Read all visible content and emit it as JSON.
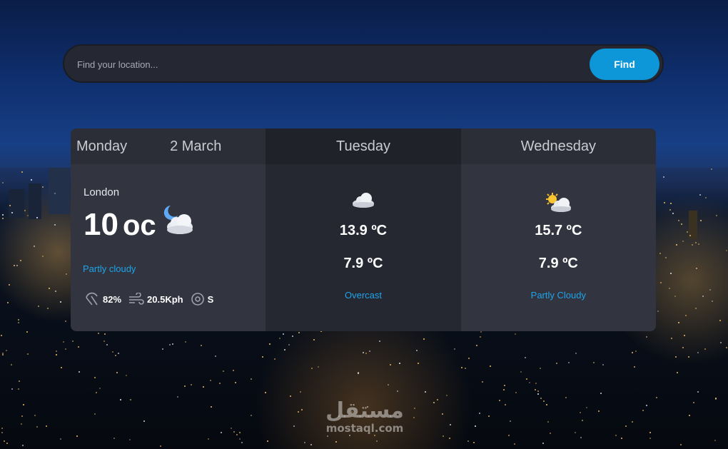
{
  "search": {
    "placeholder": "Find your location...",
    "button_label": "Find"
  },
  "today": {
    "day": "Monday",
    "date": "2 March",
    "location": "London",
    "temp": "10",
    "unit": "oc",
    "condition": "Partly cloudy",
    "icon": "moon-cloud-icon",
    "humidity": "82%",
    "wind": "20.5Kph",
    "direction": "S"
  },
  "forecast": [
    {
      "day": "Tuesday",
      "max": "13.9 ºC",
      "min": "7.9 ºC",
      "condition": "Overcast",
      "icon": "cloud-icon"
    },
    {
      "day": "Wednesday",
      "max": "15.7 ºC",
      "min": "7.9 ºC",
      "condition": "Partly Cloudy",
      "icon": "sun-cloud-icon"
    }
  ],
  "watermark": {
    "arabic": "مستقل",
    "latin": "mostaql.com"
  },
  "colors": {
    "accent": "#0d97d8",
    "condition": "#1ea4e8",
    "card_dark": "#262831",
    "card_light": "#32343f"
  }
}
